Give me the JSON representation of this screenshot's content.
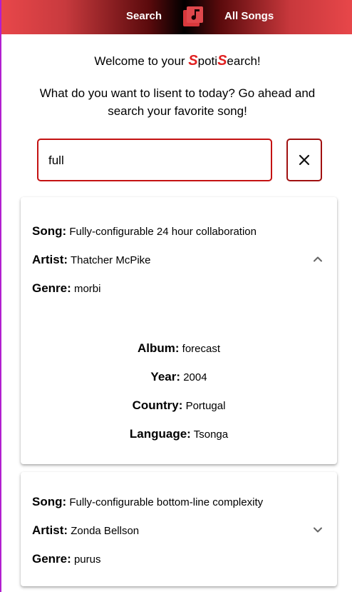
{
  "nav": {
    "search_label": "Search",
    "all_songs_label": "All Songs"
  },
  "welcome": {
    "prefix": "Welcome to your ",
    "brand_s1": "S",
    "brand_mid": "poti",
    "brand_s2": "S",
    "brand_end": "earch!"
  },
  "intro": "What do you want to lisent to today? Go ahead and search your favorite song!",
  "search": {
    "value": "full",
    "placeholder": ""
  },
  "results": [
    {
      "song_label": "Song:",
      "song": "Fully-configurable 24 hour collaboration",
      "artist_label": "Artist:",
      "artist": "Thatcher McPike",
      "genre_label": "Genre:",
      "genre": "morbi",
      "album_label": "Album:",
      "album": "forecast",
      "year_label": "Year:",
      "year": "2004",
      "country_label": "Country:",
      "country": "Portugal",
      "language_label": "Language:",
      "language": "Tsonga",
      "expanded": true
    },
    {
      "song_label": "Song:",
      "song": "Fully-configurable bottom-line complexity",
      "artist_label": "Artist:",
      "artist": "Zonda Bellson",
      "genre_label": "Genre:",
      "genre": "purus",
      "expanded": false
    }
  ],
  "colors": {
    "accent_red": "#e02020",
    "border_red": "#c41212"
  }
}
